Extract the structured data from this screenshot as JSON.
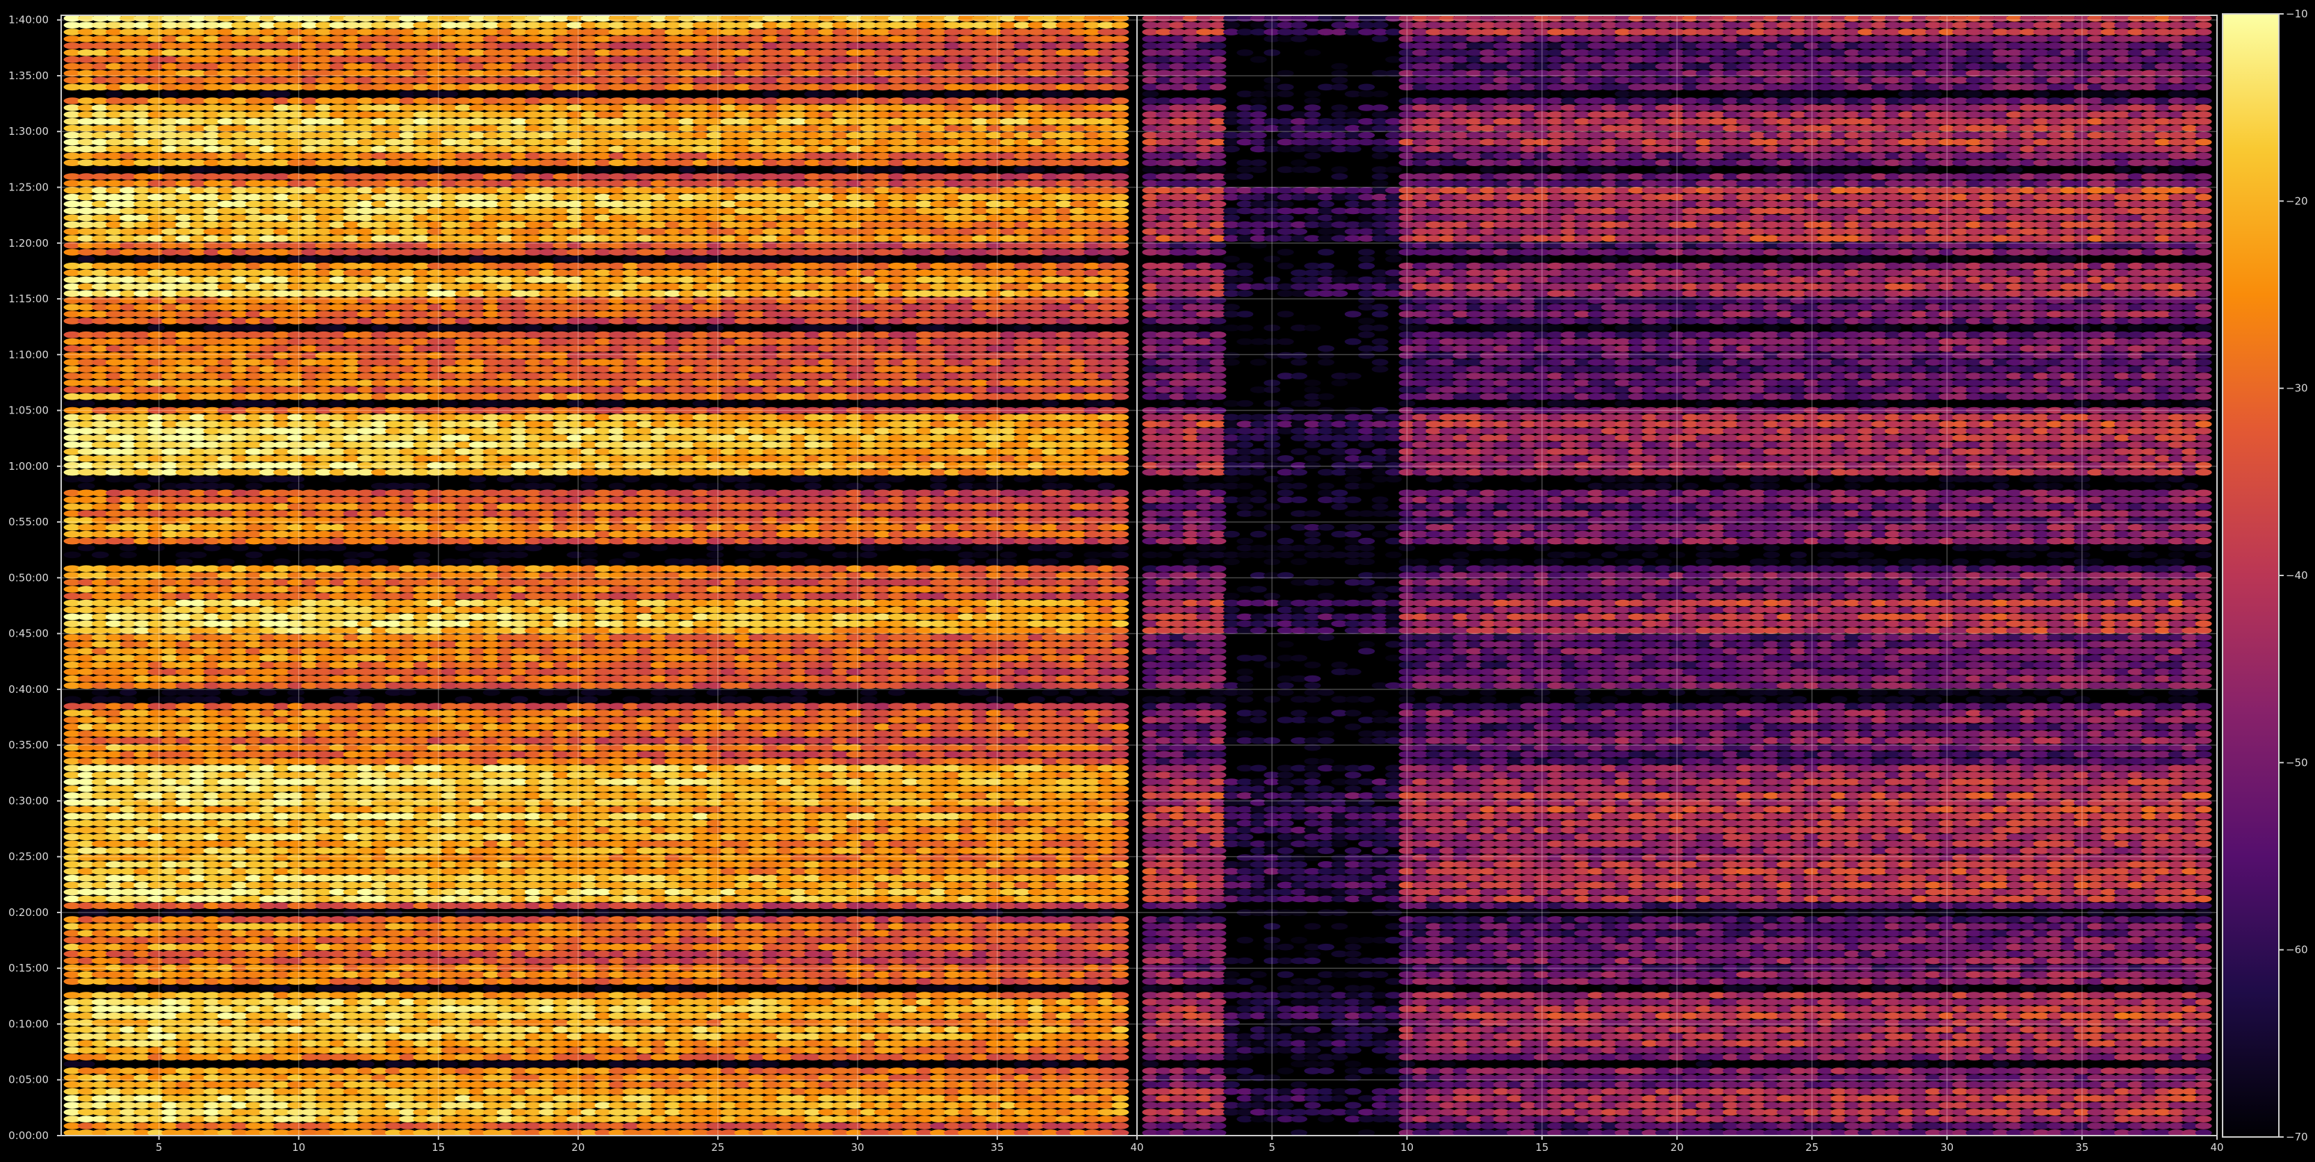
{
  "chart_data": {
    "type": "heatmap",
    "title": "",
    "xlabel": "",
    "ylabel": "",
    "grid": true,
    "colormap": "inferno",
    "background": "#000000",
    "panels": [
      {
        "name": "",
        "xlim": [
          1.5,
          40
        ],
        "xticks": [
          5,
          10,
          15,
          20,
          25,
          30,
          35,
          40
        ],
        "xticklabels": [
          "5",
          "10",
          "15",
          "20",
          "25",
          "30",
          "35",
          "40"
        ],
        "ylim_seconds": [
          0,
          6025
        ],
        "baseline_db": -26,
        "falloff_db_per_unit": 0.55,
        "noise_db": 6,
        "cell_x_step": 0.5,
        "cell_y_step_seconds": 37
      },
      {
        "name": "",
        "xlim": [
          0,
          40
        ],
        "xticks": [
          5,
          10,
          15,
          20,
          25,
          30,
          35,
          40
        ],
        "xticklabels": [
          "5",
          "10",
          "15",
          "20",
          "25",
          "30",
          "35",
          "40"
        ],
        "ylim_seconds": [
          0,
          6025
        ],
        "baseline_db": -48,
        "falloff_db_per_unit": -0.45,
        "noise_db": 7,
        "cell_x_step": 0.5,
        "cell_y_step_seconds": 37
      }
    ],
    "yticks_seconds": [
      0,
      300,
      600,
      900,
      1200,
      1500,
      1800,
      2100,
      2400,
      2700,
      3000,
      3300,
      3600,
      3900,
      4200,
      4500,
      4800,
      5100,
      5400,
      5700,
      6000
    ],
    "yticklabels": [
      "0:00:00",
      "0:05:00",
      "0:10:00",
      "0:15:00",
      "0:20:00",
      "0:25:00",
      "0:30:00",
      "0:35:00",
      "0:40:00",
      "0:45:00",
      "0:50:00",
      "0:55:00",
      "1:00:00",
      "1:05:00",
      "1:10:00",
      "1:15:00",
      "1:20:00",
      "1:25:00",
      "1:30:00",
      "1:35:00",
      "1:40:00"
    ],
    "gap_bands_seconds": [
      [
        380,
        420
      ],
      [
        770,
        820
      ],
      [
        1180,
        1230
      ],
      [
        2320,
        2400
      ],
      [
        3080,
        3160
      ],
      [
        3480,
        3530
      ],
      [
        3920,
        3970
      ],
      [
        4330,
        4380
      ],
      [
        4690,
        4740
      ],
      [
        5170,
        5220
      ],
      [
        5570,
        5620
      ],
      [
        5790,
        5820
      ]
    ],
    "bright_bands_seconds": [
      [
        60,
        260
      ],
      [
        450,
        760
      ],
      [
        1250,
        2000
      ],
      [
        2700,
        2900
      ],
      [
        3560,
        3880
      ],
      [
        4500,
        4640
      ],
      [
        4800,
        5100
      ],
      [
        5280,
        5560
      ],
      [
        5900,
        6010
      ]
    ],
    "colorbar": {
      "vmin": -70,
      "vmax": -10,
      "ticks": [
        -70,
        -60,
        -50,
        -40,
        -30,
        -20,
        -10
      ],
      "ticklabels": [
        "−70",
        "−60",
        "−50",
        "−40",
        "−30",
        "−20",
        "−10"
      ]
    }
  }
}
